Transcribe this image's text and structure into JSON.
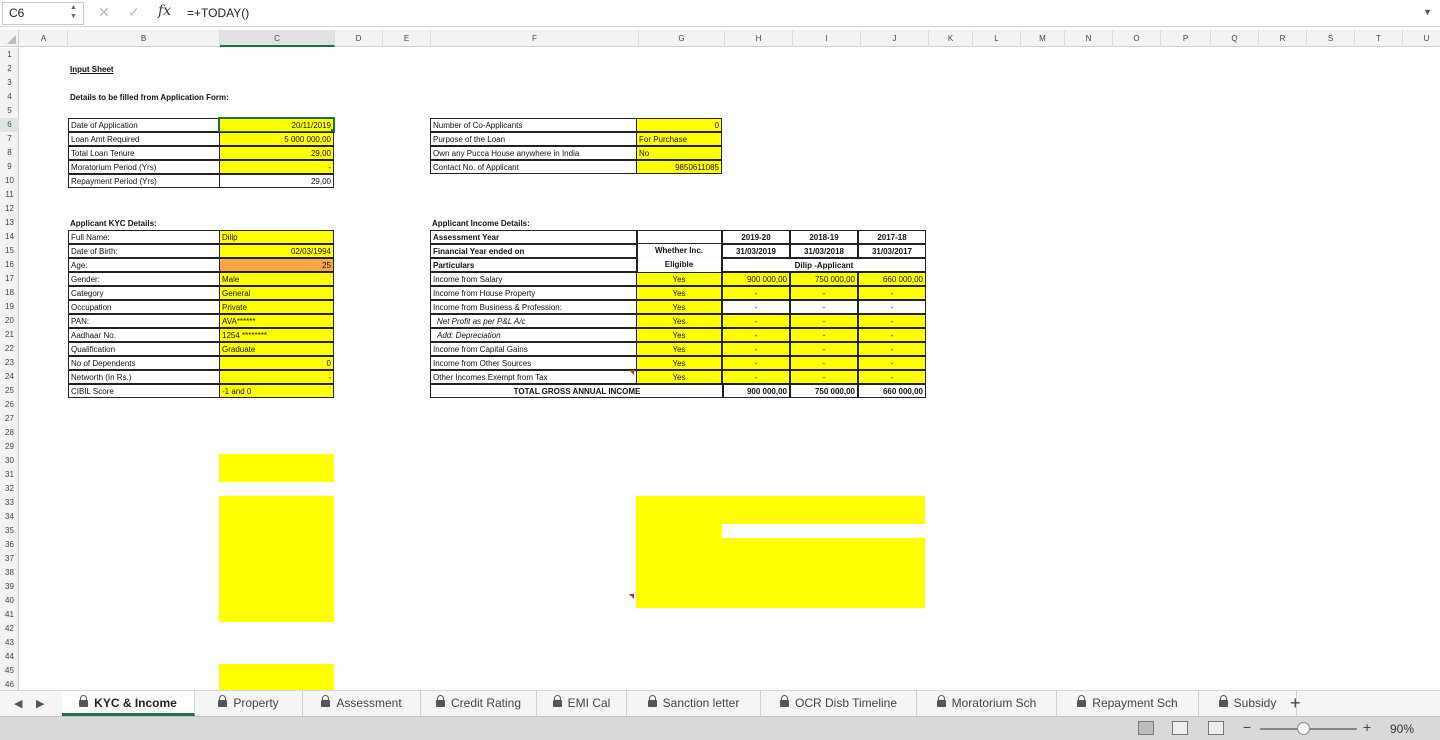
{
  "formula_bar": {
    "name_box": "C6",
    "cancel_glyph": "✕",
    "enter_glyph": "✓",
    "fx_label": "fx",
    "formula": "=+TODAY()",
    "dropdown_glyph": "▼"
  },
  "columns": [
    "A",
    "B",
    "C",
    "D",
    "E",
    "F",
    "G",
    "H",
    "I",
    "J",
    "K",
    "L",
    "M",
    "N",
    "O",
    "P",
    "Q",
    "R",
    "S",
    "T",
    "U"
  ],
  "active_column": "C",
  "rows": [
    "1",
    "2",
    "3",
    "4",
    "5",
    "6",
    "7",
    "8",
    "9",
    "10",
    "11",
    "12",
    "13",
    "14",
    "15",
    "16",
    "17",
    "18",
    "19",
    "20",
    "21",
    "22",
    "23",
    "24",
    "25",
    "26",
    "27",
    "28",
    "29",
    "30",
    "31",
    "32",
    "33",
    "34",
    "35",
    "36",
    "37",
    "38",
    "39",
    "40",
    "41",
    "42",
    "43",
    "44",
    "45",
    "46"
  ],
  "active_row": "6",
  "sheet": {
    "title": "Input Sheet",
    "subtitle": "Details to be filled from Application Form:",
    "loan_details": [
      {
        "label": "Date of Application",
        "value": "20/11/2019"
      },
      {
        "label": "Loan Amt Required",
        "value": "5 000 000,00"
      },
      {
        "label": "Total Loan Tenure",
        "value": "29,00"
      },
      {
        "label": "Moratorium Period (Yrs)",
        "value": "-"
      },
      {
        "label": "Repayment Period (Yrs)",
        "value": "29,00"
      }
    ],
    "co_applicant": [
      {
        "label": "Number of Co-Applicants",
        "value": "0"
      },
      {
        "label": "Purpose of the Loan",
        "value": "For Purchase"
      },
      {
        "label": "Own any Pucca House anywhere in India",
        "value": "No"
      },
      {
        "label": "Contact No. of Applicant",
        "value": "9850611085"
      }
    ],
    "kyc_title": "Applicant KYC Details:",
    "kyc": [
      {
        "label": "Full Name:",
        "value": "Dilip"
      },
      {
        "label": "Date of Birth:",
        "value": "02/03/1994"
      },
      {
        "label": "Age:",
        "value": "25"
      },
      {
        "label": "Gender:",
        "value": "Male"
      },
      {
        "label": "Category",
        "value": "General"
      },
      {
        "label": "Occupation",
        "value": "Private"
      },
      {
        "label": "PAN:",
        "value": "AVA******"
      },
      {
        "label": "Aadhaar No.",
        "value": "1254 ********"
      },
      {
        "label": "Qualification",
        "value": "Graduate"
      },
      {
        "label": "No of Dependents",
        "value": "0"
      },
      {
        "label": "Networth (In Rs.)",
        "value": "-"
      },
      {
        "label": "CIBIL Score",
        "value": "-1 and 0"
      }
    ],
    "income": {
      "title": "Applicant Income Details:",
      "header_assessment": "Assessment Year",
      "header_fy": "Financial Year ended on",
      "header_particulars": "Particulars",
      "eligible_header_1": "Whether Inc.",
      "eligible_header_2": "Eligible",
      "years": [
        "2019-20",
        "2018-19",
        "2017-18"
      ],
      "fy_dates": [
        "31/03/2019",
        "31/03/2018",
        "31/03/2017"
      ],
      "applicant_label": "Dilip -Applicant",
      "rows": [
        {
          "label": "Income from Salary",
          "eligible": "Yes",
          "values": [
            "900 000,00",
            "750 000,00",
            "660 000,00"
          ]
        },
        {
          "label": "Income from House Property",
          "eligible": "Yes",
          "values": [
            "-",
            "-",
            "-"
          ]
        },
        {
          "label": "Income from Business & Profession:",
          "eligible": "Yes",
          "values": [
            "-",
            "-",
            "-"
          ]
        },
        {
          "label": "Net Profit as per P&L A/c",
          "eligible": "Yes",
          "values": [
            "-",
            "-",
            "-"
          ]
        },
        {
          "label": "Add: Depreciation",
          "eligible": "Yes",
          "values": [
            "-",
            "-",
            "-"
          ]
        },
        {
          "label": "Income from Capital Gains",
          "eligible": "Yes",
          "values": [
            "-",
            "-",
            "-"
          ]
        },
        {
          "label": "Income from Other Sources",
          "eligible": "Yes",
          "values": [
            "-",
            "-",
            "-"
          ]
        },
        {
          "label": "Other Incomes Exempt from Tax",
          "eligible": "Yes",
          "values": [
            "-",
            "-",
            "-"
          ]
        }
      ],
      "total_label": "TOTAL GROSS ANNUAL INCOME",
      "totals": [
        "900 000,00",
        "750 000,00",
        "660 000,00"
      ]
    }
  },
  "tabs": [
    {
      "label": "KYC & Income",
      "active": true
    },
    {
      "label": "Property"
    },
    {
      "label": "Assessment"
    },
    {
      "label": "Credit Rating"
    },
    {
      "label": "EMI Cal"
    },
    {
      "label": "Sanction letter"
    },
    {
      "label": "OCR Disb Timeline"
    },
    {
      "label": "Moratorium Sch"
    },
    {
      "label": "Repayment Sch"
    },
    {
      "label": "Subsidy"
    }
  ],
  "tab_nav": {
    "prev": "◀",
    "next": "▶",
    "add": "+"
  },
  "status_bar": {
    "zoom": "90%",
    "zoom_minus": "−",
    "zoom_plus": "+"
  },
  "colors": {
    "input_yellow": "#ffff00",
    "computed_orange": "#f9a746",
    "excel_green": "#1e7145"
  }
}
